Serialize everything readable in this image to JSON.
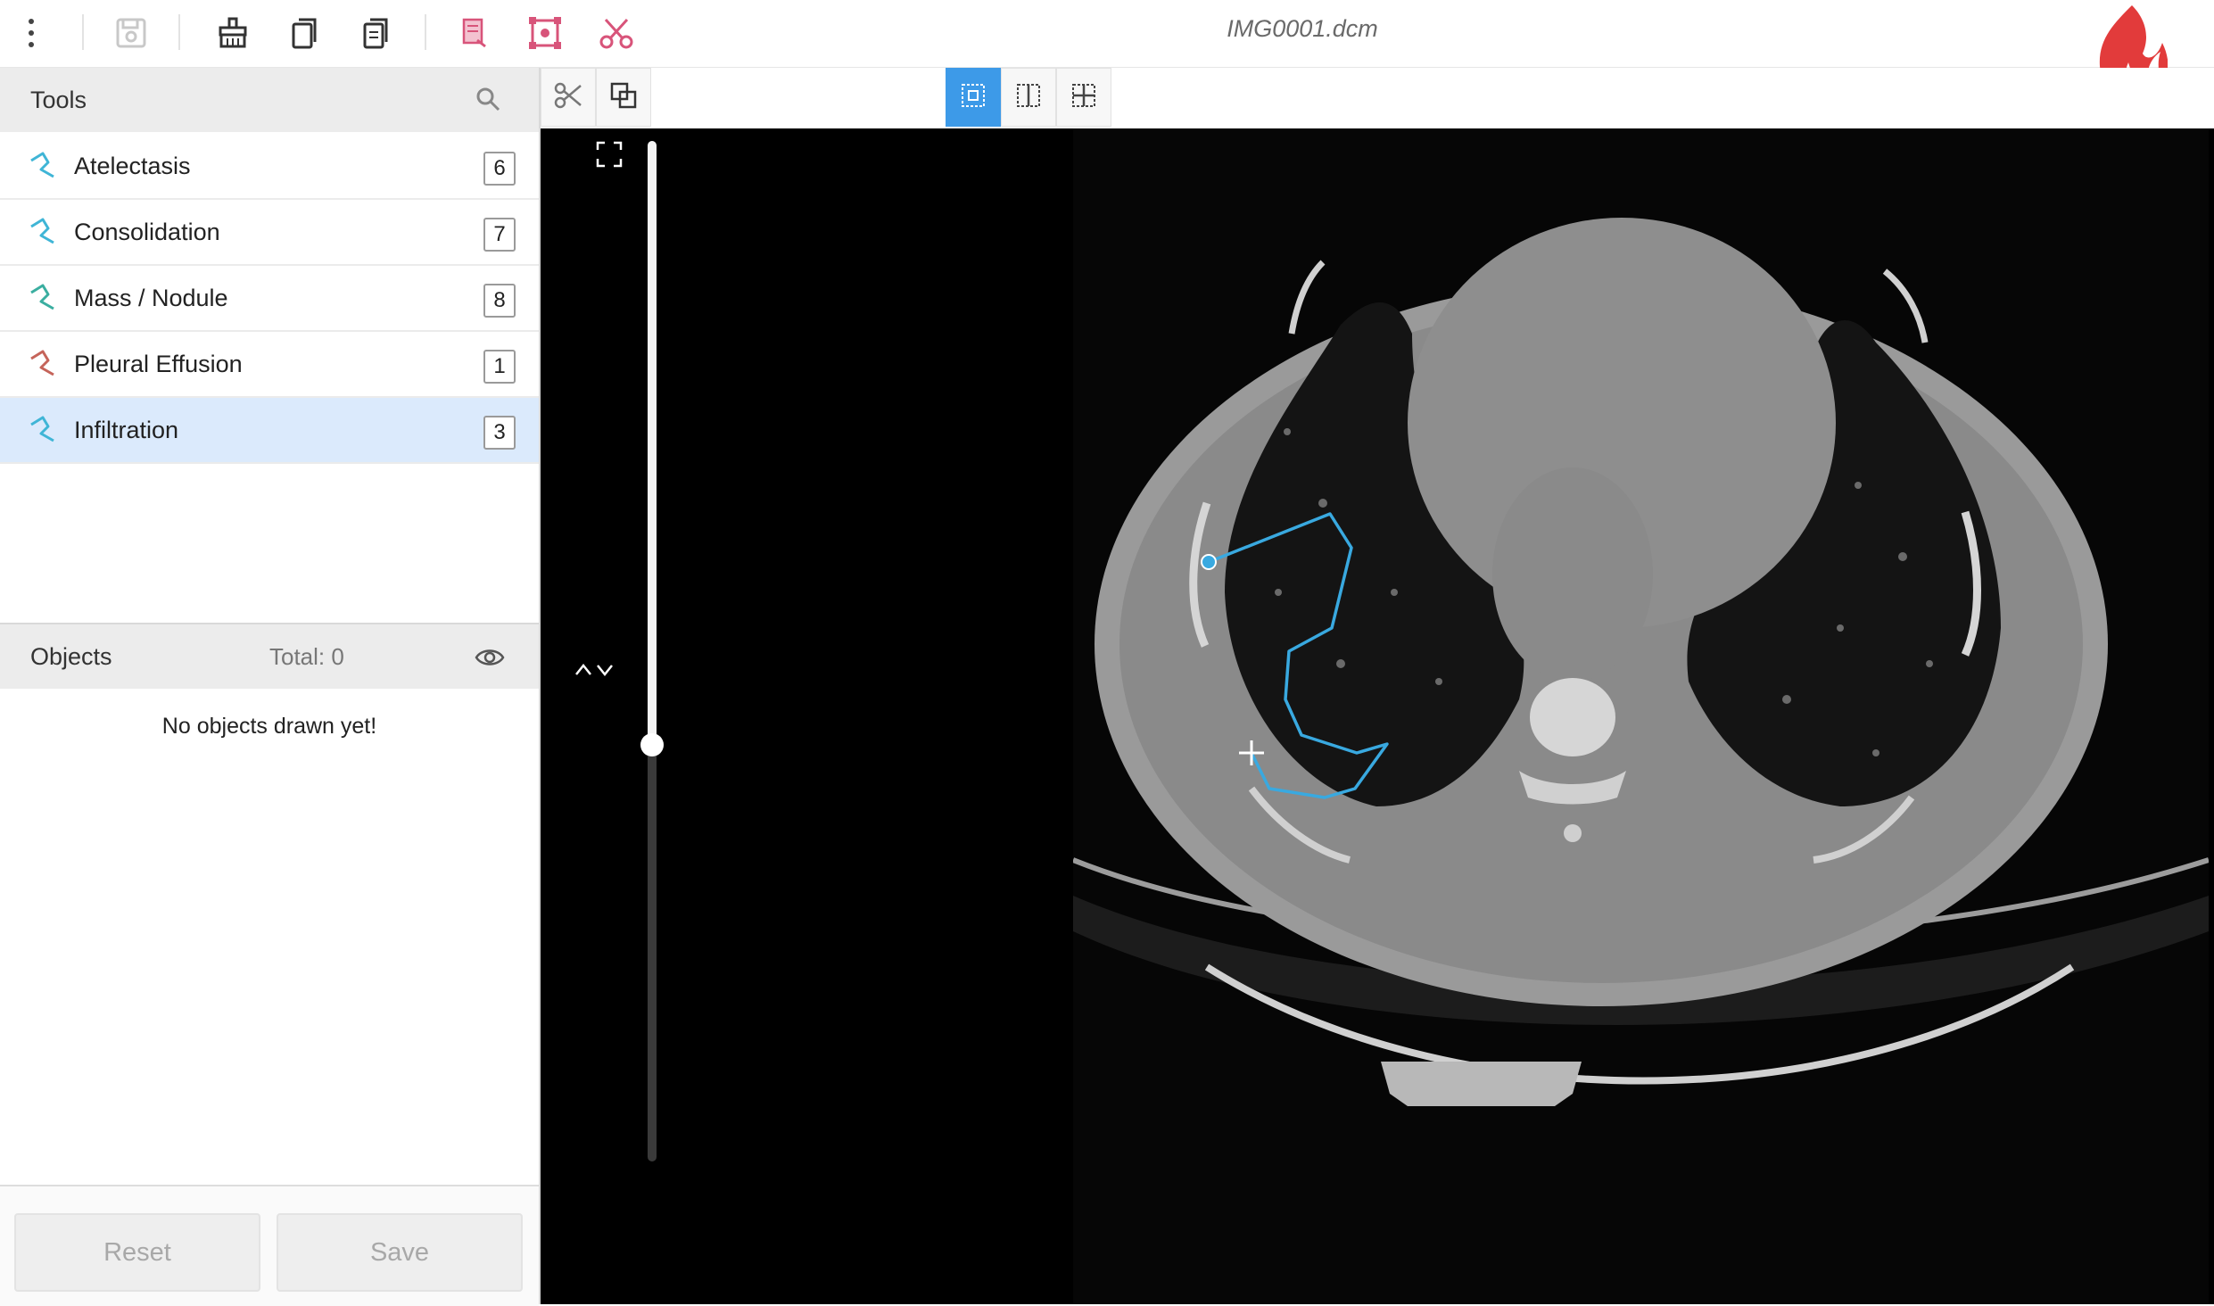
{
  "toolbar": {
    "filename": "IMG0001.dcm",
    "icons": [
      "more-vert-icon",
      "save-icon",
      "paint-icon",
      "copy-icon",
      "paste-icon",
      "edit-label-icon",
      "bounding-box-icon",
      "scissors-icon"
    ]
  },
  "tools": {
    "title": "Tools",
    "items": [
      {
        "label": "Atelectasis",
        "count": "6",
        "color": "#3fb5d6"
      },
      {
        "label": "Consolidation",
        "count": "7",
        "color": "#3fb5d6"
      },
      {
        "label": "Mass / Nodule",
        "count": "8",
        "color": "#3aaea0"
      },
      {
        "label": "Pleural Effusion",
        "count": "1",
        "color": "#c5645a"
      },
      {
        "label": "Infiltration",
        "count": "3",
        "color": "#3fb5d6"
      }
    ],
    "selected": "Infiltration"
  },
  "objects": {
    "title": "Objects",
    "total": "Total: 0",
    "empty_message": "No objects drawn yet!"
  },
  "footer": {
    "reset_label": "Reset",
    "save_label": "Save"
  },
  "viewer": {
    "layout_modes": [
      "single-view",
      "split-vertical",
      "grid-quad"
    ],
    "active_layout": "single-view",
    "slice_position": 0.59,
    "annotation_color": "#39a9e0",
    "accent_color": "#3d9ae8",
    "brand_color": "#e23b3b"
  }
}
